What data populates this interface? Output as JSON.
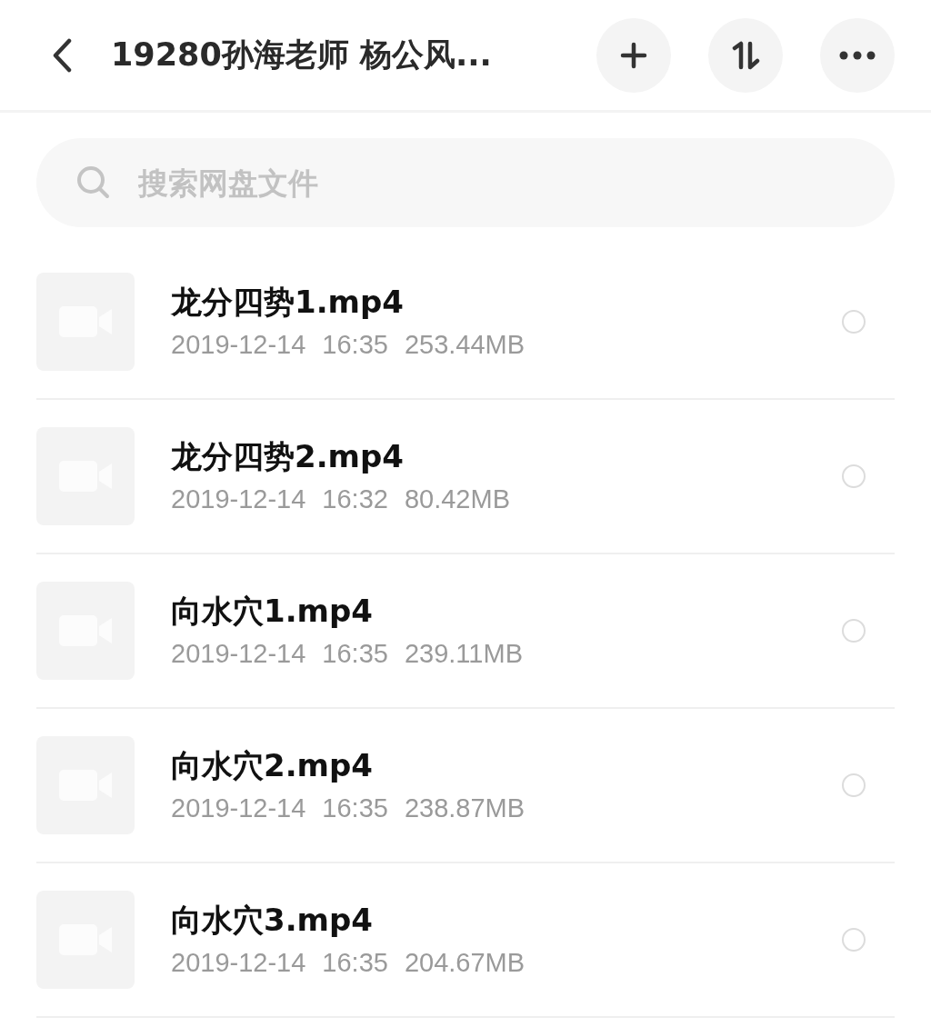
{
  "header": {
    "title": "19280孙海老师 杨公风..."
  },
  "search": {
    "placeholder": "搜索网盘文件"
  },
  "files": [
    {
      "name": "龙分四势1.mp4",
      "date": "2019-12-14",
      "time": "16:35",
      "size": "253.44MB",
      "selected": false
    },
    {
      "name": "龙分四势2.mp4",
      "date": "2019-12-14",
      "time": "16:32",
      "size": "80.42MB",
      "selected": false
    },
    {
      "name": "向水穴1.mp4",
      "date": "2019-12-14",
      "time": "16:35",
      "size": "239.11MB",
      "selected": false
    },
    {
      "name": "向水穴2.mp4",
      "date": "2019-12-14",
      "time": "16:35",
      "size": "238.87MB",
      "selected": false
    },
    {
      "name": "向水穴3.mp4",
      "date": "2019-12-14",
      "time": "16:35",
      "size": "204.67MB",
      "selected": false
    }
  ]
}
